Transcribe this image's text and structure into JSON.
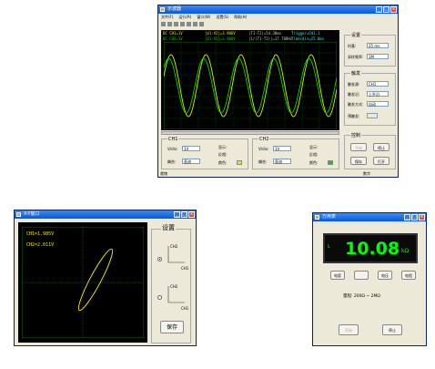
{
  "scope_window": {
    "title": "示波器",
    "menu": [
      "文件(F)",
      "运行(R)",
      "窗口(W)",
      "设置(S)",
      "帮助(H)"
    ],
    "readouts": {
      "ch1_v": "DC  CH1=1V",
      "v1v2": "|V1-V2|=3.986V",
      "t1t2": "|T1-T2|=54.38ms",
      "trigger": "Trigger=CH1.1",
      "ch2_v": "DC  CH2=1V",
      "v1v2_b": "|V1-V2|=3.986V",
      "freq": "|1/(T1-T2)|=17.788Hz",
      "timediv": "Time/div=25.0ms"
    },
    "settings": {
      "title": "设置",
      "timebase_label": "时基:",
      "timebase_value": "25 ms",
      "samplerate_label": "采样频率:",
      "samplerate_value": "1M"
    },
    "trigger": {
      "title": "触发",
      "source_label": "触发源:",
      "source_value": "CH1",
      "edge_label": "触发沿:",
      "edge_value": "上升沿",
      "mode_label": "触发方式:",
      "mode_value": "自动",
      "pretrigger_label": "预触发:"
    },
    "control": {
      "title": "控制",
      "start": "开始",
      "stop": "停止",
      "save": "保存",
      "open": "打开"
    },
    "ch1": {
      "title": "CH1",
      "vdiv_label": "V/div:",
      "vdiv_value": "1V",
      "coupling_label": "耦合:",
      "coupling_value": "直流",
      "show_label": "显示:",
      "invert_label": "反相:",
      "color_label": "颜色:",
      "color": "#e8e800"
    },
    "ch2": {
      "title": "CH2",
      "vdiv_label": "V/div:",
      "vdiv_value": "1V",
      "coupling_label": "耦合:",
      "coupling_value": "直流",
      "show_label": "显示:",
      "invert_label": "反相:",
      "color_label": "颜色:",
      "color": "#00d800"
    },
    "status_left": "就绪",
    "status_right": "数字"
  },
  "xy_window": {
    "title": "X-Y窗口",
    "ch1_readout": "CH1=1.985V",
    "ch2_readout": "CH2=2.011V",
    "settings_title": "设置",
    "axis_h": "CH1",
    "axis_v": "CH2",
    "axis_h2": "CH2",
    "axis_v2": "CH1",
    "save_button": "保存"
  },
  "meter_window": {
    "title": "万用表",
    "value": "10.08",
    "unit": "kΩ",
    "mode_indicator": "L",
    "buttons": [
      "电容",
      "",
      "电压",
      "电阻"
    ],
    "range": "量程: 200Ω ~ 2MΩ",
    "start": "开始",
    "stop": "停止"
  },
  "colors": {
    "titlebar": "#0a58d8",
    "trace_ch1": "#e8e800",
    "trace_ch2": "#00d800",
    "meter_digits": "#00ff00"
  }
}
